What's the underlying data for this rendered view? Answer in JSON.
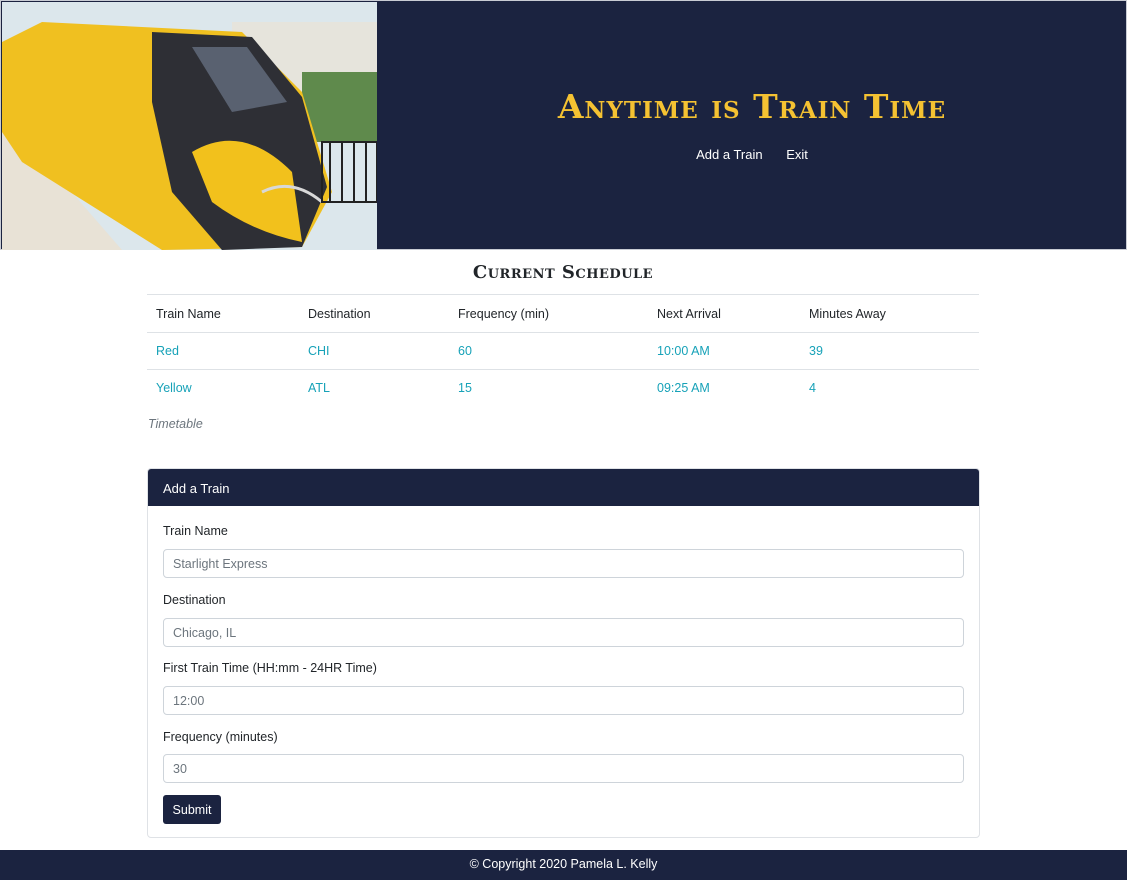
{
  "header": {
    "title": "Anytime is Train Time",
    "nav": {
      "add_train": "Add a Train",
      "exit": "Exit"
    }
  },
  "schedule": {
    "title": "Current Schedule",
    "columns": [
      "Train Name",
      "Destination",
      "Frequency (min)",
      "Next Arrival",
      "Minutes Away"
    ],
    "rows": [
      [
        "Red",
        "CHI",
        "60",
        "10:00 AM",
        "39"
      ],
      [
        "Yellow",
        "ATL",
        "15",
        "09:25 AM",
        "4"
      ]
    ],
    "caption": "Timetable"
  },
  "form": {
    "header": "Add a Train",
    "train_name": {
      "label": "Train Name",
      "placeholder": "Starlight Express"
    },
    "destination": {
      "label": "Destination",
      "placeholder": "Chicago, IL"
    },
    "first_time": {
      "label": "First Train Time (HH:mm - 24HR Time)",
      "placeholder": "12:00"
    },
    "frequency": {
      "label": "Frequency (minutes)",
      "placeholder": "30"
    },
    "submit_label": "Submit"
  },
  "footer": {
    "text": "© Copyright 2020 Pamela L. Kelly"
  },
  "colors": {
    "navy": "#1b2340",
    "gold": "#f5c232",
    "teal": "#17a2b8"
  }
}
